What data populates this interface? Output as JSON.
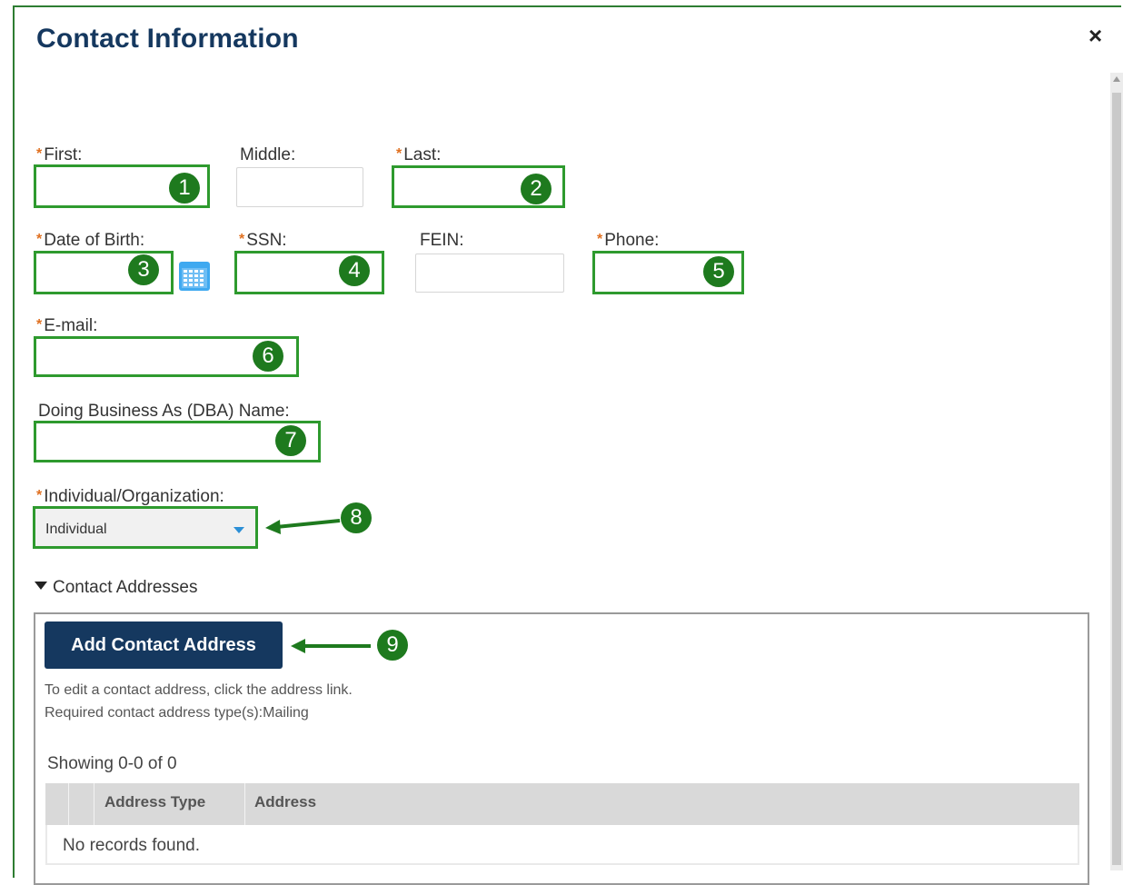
{
  "dialog": {
    "title": "Contact Information",
    "close_label": "×"
  },
  "form": {
    "first_label": "First:",
    "middle_label": "Middle:",
    "last_label": "Last:",
    "dob_label": "Date of Birth:",
    "ssn_label": "SSN:",
    "fein_label": "FEIN:",
    "phone_label": "Phone:",
    "email_label": "E-mail:",
    "dba_label": "Doing Business As (DBA) Name:",
    "type_label": "Individual/Organization:",
    "type_value": "Individual",
    "first_value": "",
    "middle_value": "",
    "last_value": "",
    "dob_value": "",
    "ssn_value": "",
    "fein_value": "",
    "phone_value": "",
    "email_value": "",
    "dba_value": ""
  },
  "callouts": [
    "1",
    "2",
    "3",
    "4",
    "5",
    "6",
    "7",
    "8",
    "9"
  ],
  "addresses": {
    "section_label": "Contact Addresses",
    "add_button": "Add Contact Address",
    "help_line1": "To edit a contact address, click the address link.",
    "help_line2": "Required contact address type(s):Mailing",
    "showing": "Showing 0-0 of 0",
    "columns": [
      "Address Type",
      "Address"
    ],
    "empty_message": "No records found."
  },
  "colors": {
    "title": "#15385f",
    "highlight": "#2e9a2e",
    "badge": "#1e7a1e",
    "button": "#15385f",
    "required_star": "#e07020"
  },
  "icons": {
    "calendar": "calendar-icon",
    "close": "close-icon",
    "dropdown": "chevron-down-icon"
  }
}
